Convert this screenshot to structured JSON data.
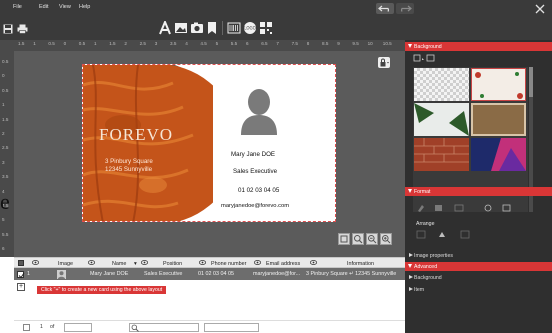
{
  "menubar": {
    "items": [
      "File",
      "Edit",
      "View",
      "Help"
    ]
  },
  "ruler": {
    "h_ticks": [
      "1.5",
      "1",
      "0.5",
      "0",
      "0.5",
      "1",
      "1.5",
      "2",
      "2.5",
      "3",
      "3.5",
      "4",
      "4.5",
      "5",
      "5.5",
      "6",
      "6.5",
      "7",
      "7.5",
      "8",
      "8.5",
      "9",
      "9.5",
      "10",
      "10.5"
    ],
    "v_ticks": [
      "0.5",
      "0",
      "0.5",
      "1",
      "1.5",
      "2",
      "2.5",
      "3",
      "3.5",
      "4",
      "4.5",
      "5",
      "5.5",
      "6"
    ]
  },
  "card": {
    "company": "FOREVO",
    "address1": "3 Pinbury Square",
    "address2": "12345 Sunnyville",
    "name": "Mary Jane DOE",
    "position": "Sales Executive",
    "phone": "01 02 03 04 05",
    "email": "maryjanedoe@forevo.com"
  },
  "panel": {
    "background": "Background",
    "format": "Format",
    "arrange": "Arrange",
    "image_properties": "Image properties",
    "advanced": "Advanced",
    "adv_background": "Background",
    "adv_item": "Item"
  },
  "grid": {
    "headers": [
      "Image",
      "Name",
      "Position",
      "Phone number",
      "Email address",
      "Information"
    ],
    "row": {
      "index": "1",
      "name": "Mary Jane DOE",
      "position": "Sales Executive",
      "phone": "01 02 03 04 05",
      "email": "maryjanedoe@for...",
      "information": "3 Pinbury Square ↵ 12345 Sunnyville"
    },
    "hint": "Click \"+\" to create a new card using the above layout",
    "add": "+"
  },
  "pager": {
    "page_label": "1",
    "of": "of"
  },
  "colors": {
    "accent": "#d93636",
    "dark_bg": "#3a3a3a",
    "panel_bg": "#2f2f2f"
  },
  "side_letter": "e"
}
